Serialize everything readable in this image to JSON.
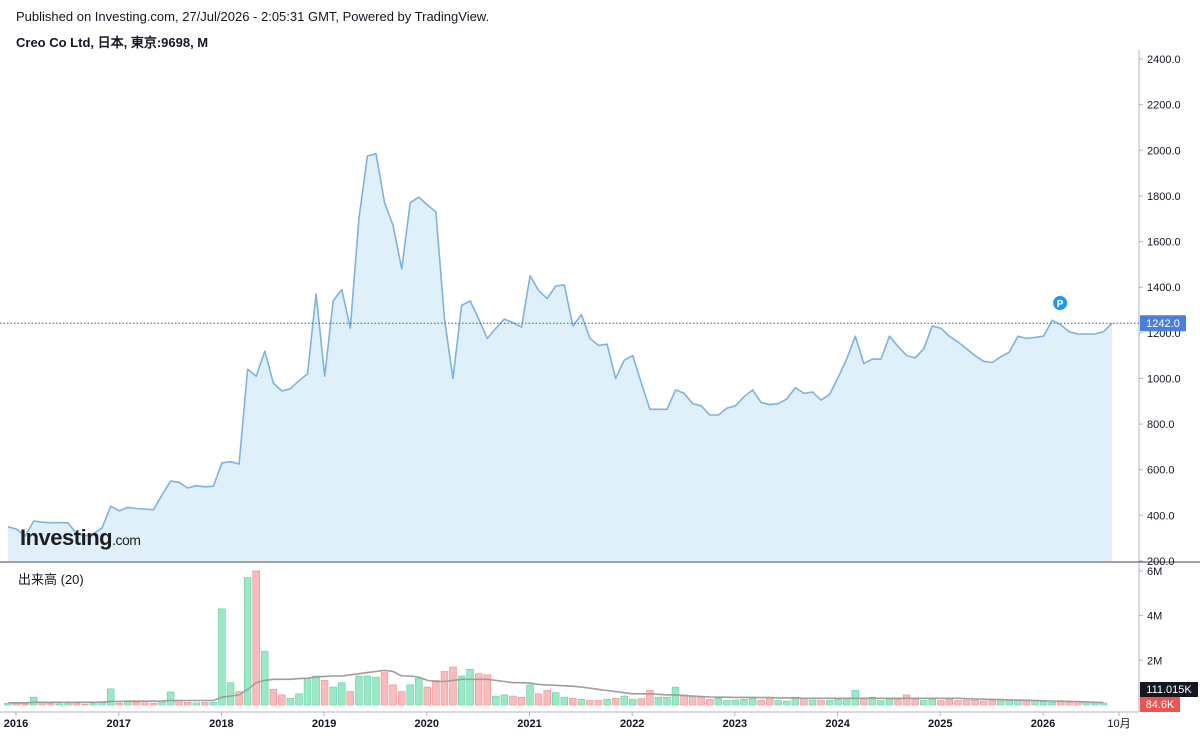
{
  "header": {
    "published": "Published on Investing.com, 27/Jul/2026 - 2:05:31 GMT, Powered by TradingView.",
    "instrument": "Creo Co Ltd, 日本, 東京:9698, M"
  },
  "logo": {
    "main": "Investing",
    "suffix": ".com"
  },
  "colors": {
    "line": "#7fb2e0",
    "fill": "#dff0fb",
    "up": "#9be8c6",
    "down": "#f8bcbc",
    "badge": "#4a7de0",
    "ma": "#9e9e9e"
  },
  "chart_data": [
    {
      "type": "area",
      "ylim": [
        200,
        2400
      ],
      "y_ticks": [
        "2400.0",
        "2200.0",
        "2000.0",
        "1800.0",
        "1600.0",
        "1400.0",
        "1200.0",
        "1000.0",
        "800.0",
        "600.0",
        "400.0",
        "200.0"
      ],
      "last_value_label": "1242.0",
      "last_value": 1242,
      "marker_label": "P",
      "x_ticks": [
        "2016",
        "2017",
        "2018",
        "2019",
        "2020",
        "2021",
        "2022",
        "2023",
        "2024",
        "2025",
        "2026",
        "10月"
      ],
      "x_start": 2016.0,
      "x_months": 129,
      "values": [
        350,
        340,
        310,
        375,
        370,
        368,
        368,
        368,
        320,
        310,
        320,
        345,
        440,
        420,
        435,
        430,
        428,
        425,
        490,
        550,
        545,
        520,
        530,
        525,
        528,
        630,
        635,
        625,
        1040,
        1010,
        1120,
        980,
        945,
        955,
        990,
        1020,
        1370,
        1010,
        1340,
        1390,
        1220,
        1700,
        1975,
        1985,
        1770,
        1670,
        1480,
        1770,
        1795,
        1760,
        1730,
        1260,
        1000,
        1320,
        1340,
        1260,
        1175,
        1220,
        1260,
        1245,
        1225,
        1450,
        1385,
        1350,
        1405,
        1410,
        1230,
        1280,
        1175,
        1145,
        1150,
        1000,
        1080,
        1100,
        980,
        865,
        865,
        865,
        950,
        935,
        890,
        880,
        840,
        840,
        870,
        880,
        920,
        950,
        895,
        885,
        890,
        910,
        960,
        935,
        940,
        905,
        930,
        1005,
        1085,
        1185,
        1065,
        1085,
        1085,
        1185,
        1140,
        1100,
        1090,
        1130,
        1230,
        1220,
        1185,
        1160,
        1130,
        1100,
        1075,
        1070,
        1095,
        1115,
        1185,
        1175,
        1180,
        1185,
        1255,
        1235,
        1205,
        1195,
        1195,
        1195,
        1205,
        1242
      ]
    },
    {
      "type": "bar",
      "title": "出来高 (20)",
      "ylim": [
        0,
        6.4
      ],
      "y_ticks": [
        "6M",
        "4M",
        "2M"
      ],
      "last_ma_label": "111.015K",
      "last_volume_label": "84.6K",
      "values": [
        0.08,
        0.06,
        0.05,
        0.35,
        0.12,
        0.07,
        0.05,
        0.06,
        0.09,
        0.04,
        0.06,
        0.1,
        0.72,
        0.08,
        0.15,
        0.12,
        0.1,
        0.08,
        0.14,
        0.58,
        0.2,
        0.12,
        0.1,
        0.11,
        0.12,
        4.3,
        1.0,
        0.6,
        5.7,
        6.0,
        2.4,
        0.7,
        0.45,
        0.3,
        0.5,
        1.2,
        1.3,
        1.1,
        0.8,
        1.0,
        0.6,
        1.3,
        1.3,
        1.25,
        1.45,
        0.9,
        0.6,
        0.9,
        1.2,
        0.8,
        1.1,
        1.5,
        1.7,
        1.3,
        1.6,
        1.4,
        1.35,
        0.4,
        0.45,
        0.4,
        0.35,
        0.9,
        0.5,
        0.65,
        0.55,
        0.35,
        0.3,
        0.25,
        0.2,
        0.2,
        0.25,
        0.3,
        0.4,
        0.25,
        0.28,
        0.65,
        0.35,
        0.35,
        0.8,
        0.45,
        0.4,
        0.35,
        0.25,
        0.3,
        0.2,
        0.22,
        0.25,
        0.3,
        0.22,
        0.35,
        0.2,
        0.18,
        0.35,
        0.28,
        0.22,
        0.2,
        0.2,
        0.25,
        0.3,
        0.65,
        0.3,
        0.35,
        0.2,
        0.25,
        0.25,
        0.45,
        0.25,
        0.2,
        0.25,
        0.2,
        0.25,
        0.2,
        0.2,
        0.22,
        0.18,
        0.2,
        0.18,
        0.2,
        0.2,
        0.2,
        0.22,
        0.15,
        0.12,
        0.15,
        0.12,
        0.15,
        0.12,
        0.1,
        0.09
      ],
      "ma_values": [
        0.1,
        0.1,
        0.1,
        0.12,
        0.12,
        0.12,
        0.12,
        0.12,
        0.12,
        0.12,
        0.12,
        0.13,
        0.16,
        0.16,
        0.17,
        0.17,
        0.17,
        0.17,
        0.18,
        0.2,
        0.2,
        0.2,
        0.2,
        0.2,
        0.2,
        0.35,
        0.4,
        0.45,
        0.7,
        1.0,
        1.1,
        1.15,
        1.15,
        1.15,
        1.18,
        1.2,
        1.25,
        1.28,
        1.3,
        1.3,
        1.35,
        1.4,
        1.45,
        1.5,
        1.55,
        1.5,
        1.3,
        1.3,
        1.25,
        1.1,
        1.05,
        1.05,
        1.1,
        1.15,
        1.15,
        1.15,
        1.15,
        1.1,
        1.05,
        1.0,
        1.0,
        0.98,
        0.92,
        0.9,
        0.88,
        0.86,
        0.84,
        0.8,
        0.75,
        0.7,
        0.65,
        0.6,
        0.55,
        0.5,
        0.5,
        0.5,
        0.48,
        0.45,
        0.45,
        0.42,
        0.4,
        0.38,
        0.36,
        0.35,
        0.35,
        0.34,
        0.34,
        0.34,
        0.33,
        0.33,
        0.32,
        0.32,
        0.32,
        0.3,
        0.3,
        0.3,
        0.3,
        0.3,
        0.3,
        0.3,
        0.3,
        0.3,
        0.3,
        0.3,
        0.3,
        0.3,
        0.3,
        0.3,
        0.3,
        0.3,
        0.3,
        0.3,
        0.28,
        0.27,
        0.26,
        0.25,
        0.24,
        0.23,
        0.22,
        0.21,
        0.2,
        0.19,
        0.18,
        0.17,
        0.16,
        0.15,
        0.14,
        0.12,
        0.11
      ]
    }
  ]
}
